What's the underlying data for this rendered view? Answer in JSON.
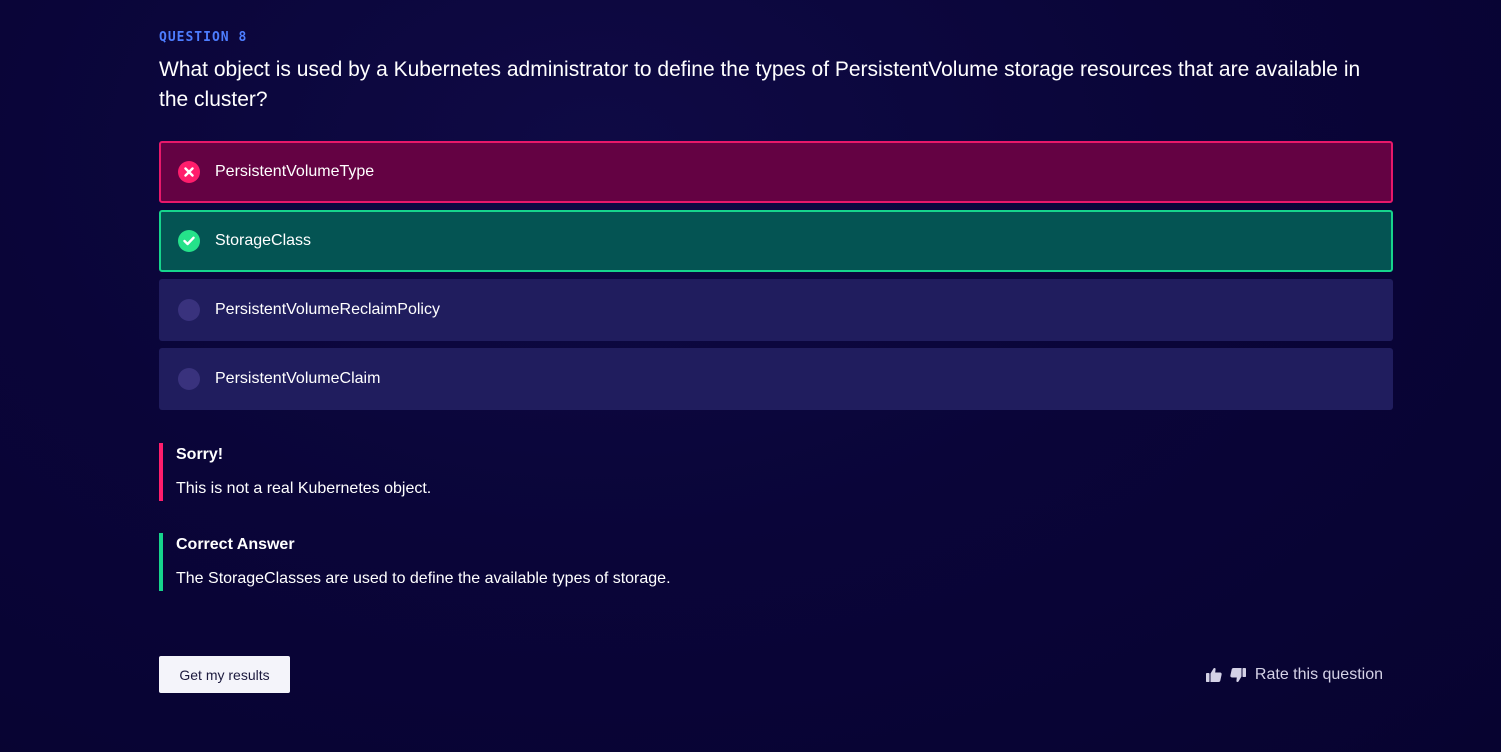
{
  "question": {
    "label": "QUESTION 8",
    "text": "What object is used by a Kubernetes administrator to define the types of PersistentVolume storage resources that are available in the cluster?"
  },
  "options": [
    {
      "label": "PersistentVolumeType",
      "state": "wrong",
      "icon": "x-circle-icon"
    },
    {
      "label": "StorageClass",
      "state": "correct",
      "icon": "check-circle-icon"
    },
    {
      "label": "PersistentVolumeReclaimPolicy",
      "state": "unselected",
      "icon": "radio-icon"
    },
    {
      "label": "PersistentVolumeClaim",
      "state": "unselected",
      "icon": "radio-icon"
    }
  ],
  "feedback": {
    "sorry_title": "Sorry!",
    "sorry_body": "This is not a real Kubernetes object.",
    "correct_title": "Correct Answer",
    "correct_body": "The StorageClasses are used to define the available types of storage."
  },
  "footer": {
    "results_button": "Get my results",
    "rate_label": "Rate this question"
  },
  "colors": {
    "background": "#0a0539",
    "accent_blue": "#4d7dff",
    "wrong": "#ff1d6c",
    "correct": "#16d48c",
    "option_bg": "#201d5e"
  }
}
